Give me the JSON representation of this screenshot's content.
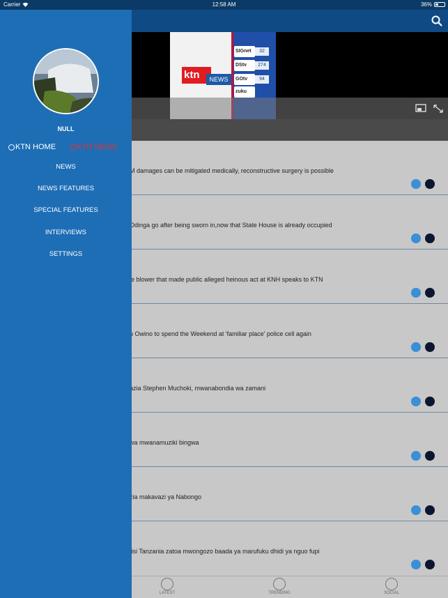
{
  "status_bar": {
    "carrier": "Carrier",
    "time": "12:58 AM",
    "battery": "36%"
  },
  "icons": {
    "search": "search-icon",
    "wifi": "wifi-icon",
    "battery": "battery-icon",
    "screencast": "screencast-icon",
    "fullscreen": "fullscreen-icon",
    "share": "share-icon",
    "bookmark": "bookmark-icon"
  },
  "video": {
    "brand": "ktn",
    "brand_sub": "NEWS",
    "channels": [
      {
        "name": "SIGnet",
        "num": "32"
      },
      {
        "name": "DStv",
        "num": "274"
      },
      {
        "name": "GOtv",
        "num": "94"
      },
      {
        "name": "zuku"
      }
    ]
  },
  "articles": [
    {
      "title": "M damages can be mitigated medically, reconstructive surgery is possible"
    },
    {
      "title": "Odinga go after being sworn in,now that State House is already occupied"
    },
    {
      "title": "le blower that made public alleged heinous act at KNH speaks to KTN"
    },
    {
      "title": "u Owino to spend the Weekend at 'familiar place' police cell again"
    },
    {
      "title": "azia Stephen Muchoki, mwanabondia wa zamani"
    },
    {
      "title": "wa mwanamuziki bingwa"
    },
    {
      "title": "zia makavazi ya Nabongo"
    },
    {
      "title": "fisi Tanzania zatoa mwongozo baada ya marufuku dhidi ya nguo fupi"
    }
  ],
  "tabs": [
    {
      "label": "LATEST",
      "icon": "megaphone-icon"
    },
    {
      "label": "TRENDING",
      "icon": "flame-icon"
    },
    {
      "label": "SOCIAL",
      "icon": "people-icon"
    }
  ],
  "drawer": {
    "username": "NULL",
    "radio": [
      {
        "label": "KTN HOME",
        "selected": true,
        "color": "#ffffff"
      },
      {
        "label": "KTN NEWS",
        "selected": false,
        "color": "#e0332f"
      }
    ],
    "menu": [
      "NEWS",
      "NEWS FEATURES",
      "SPECIAL FEATURES",
      "INTERVIEWS",
      "SETTINGS"
    ]
  },
  "colors": {
    "drawer": "#1e6eb6",
    "topbar": "#0f4a85",
    "accent_red": "#e0332f"
  }
}
